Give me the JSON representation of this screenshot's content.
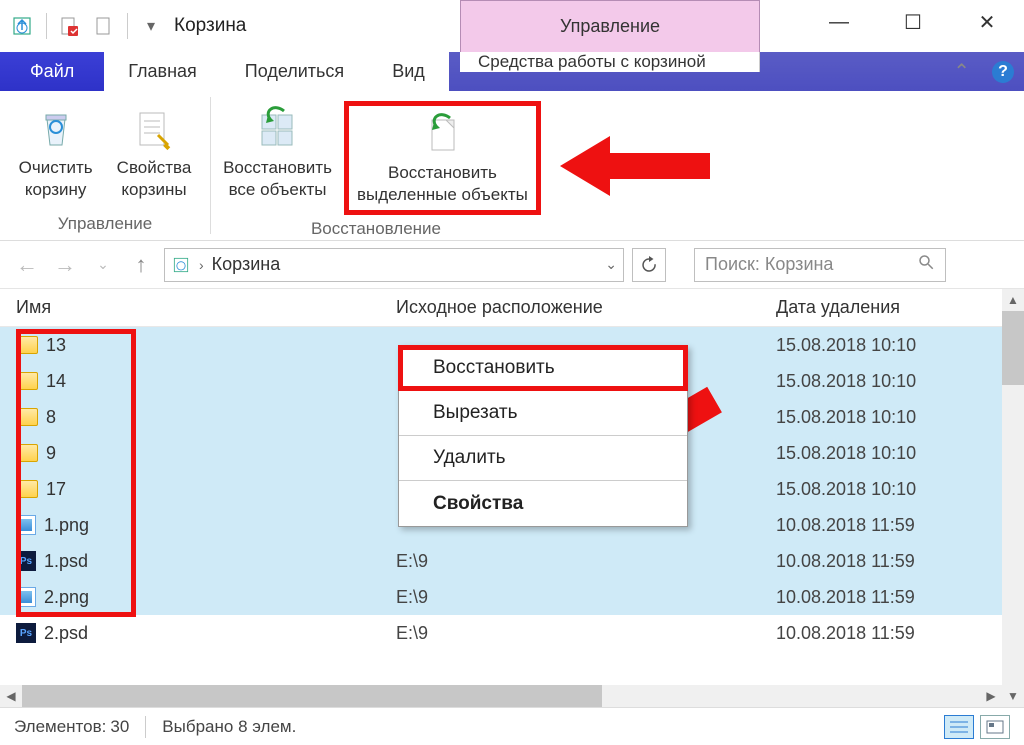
{
  "titlebar": {
    "title": "Корзина",
    "management_tab": "Управление"
  },
  "window_controls": {
    "minimize": "—",
    "maximize": "☐",
    "close": "✕"
  },
  "tabs": {
    "file": "Файл",
    "home": "Главная",
    "share": "Поделиться",
    "view": "Вид",
    "tools": "Средства работы с корзиной"
  },
  "ribbon": {
    "empty_bin": "Очистить корзину",
    "bin_props": "Свойства корзины",
    "restore_all": "Восстановить все объекты",
    "restore_selected": "Восстановить выделенные объекты",
    "group_manage": "Управление",
    "group_restore": "Восстановление"
  },
  "addressbar": {
    "location": "Корзина"
  },
  "search": {
    "placeholder": "Поиск: Корзина"
  },
  "columns": {
    "name": "Имя",
    "original_location": "Исходное расположение",
    "date_deleted": "Дата удаления"
  },
  "files": [
    {
      "name": "13",
      "type": "folder",
      "loc": "",
      "date": "15.08.2018 10:10",
      "sel": true
    },
    {
      "name": "14",
      "type": "folder",
      "loc": "",
      "date": "15.08.2018 10:10",
      "sel": true
    },
    {
      "name": "8",
      "type": "folder",
      "loc": "",
      "date": "15.08.2018 10:10",
      "sel": true
    },
    {
      "name": "9",
      "type": "folder",
      "loc": "",
      "date": "15.08.2018 10:10",
      "sel": true
    },
    {
      "name": "17",
      "type": "folder",
      "loc": "",
      "date": "15.08.2018 10:10",
      "sel": true
    },
    {
      "name": "1.png",
      "type": "img",
      "loc": "",
      "date": "10.08.2018 11:59",
      "sel": true
    },
    {
      "name": "1.psd",
      "type": "psd",
      "loc": "E:\\9",
      "date": "10.08.2018 11:59",
      "sel": true
    },
    {
      "name": "2.png",
      "type": "img",
      "loc": "E:\\9",
      "date": "10.08.2018 11:59",
      "sel": true
    },
    {
      "name": "2.psd",
      "type": "psd",
      "loc": "E:\\9",
      "date": "10.08.2018 11:59",
      "sel": false
    }
  ],
  "context_menu": {
    "restore": "Восстановить",
    "cut": "Вырезать",
    "delete": "Удалить",
    "properties": "Свойства"
  },
  "statusbar": {
    "elements_label": "Элементов:",
    "elements_count": "30",
    "selected_label": "Выбрано 8 элем."
  }
}
